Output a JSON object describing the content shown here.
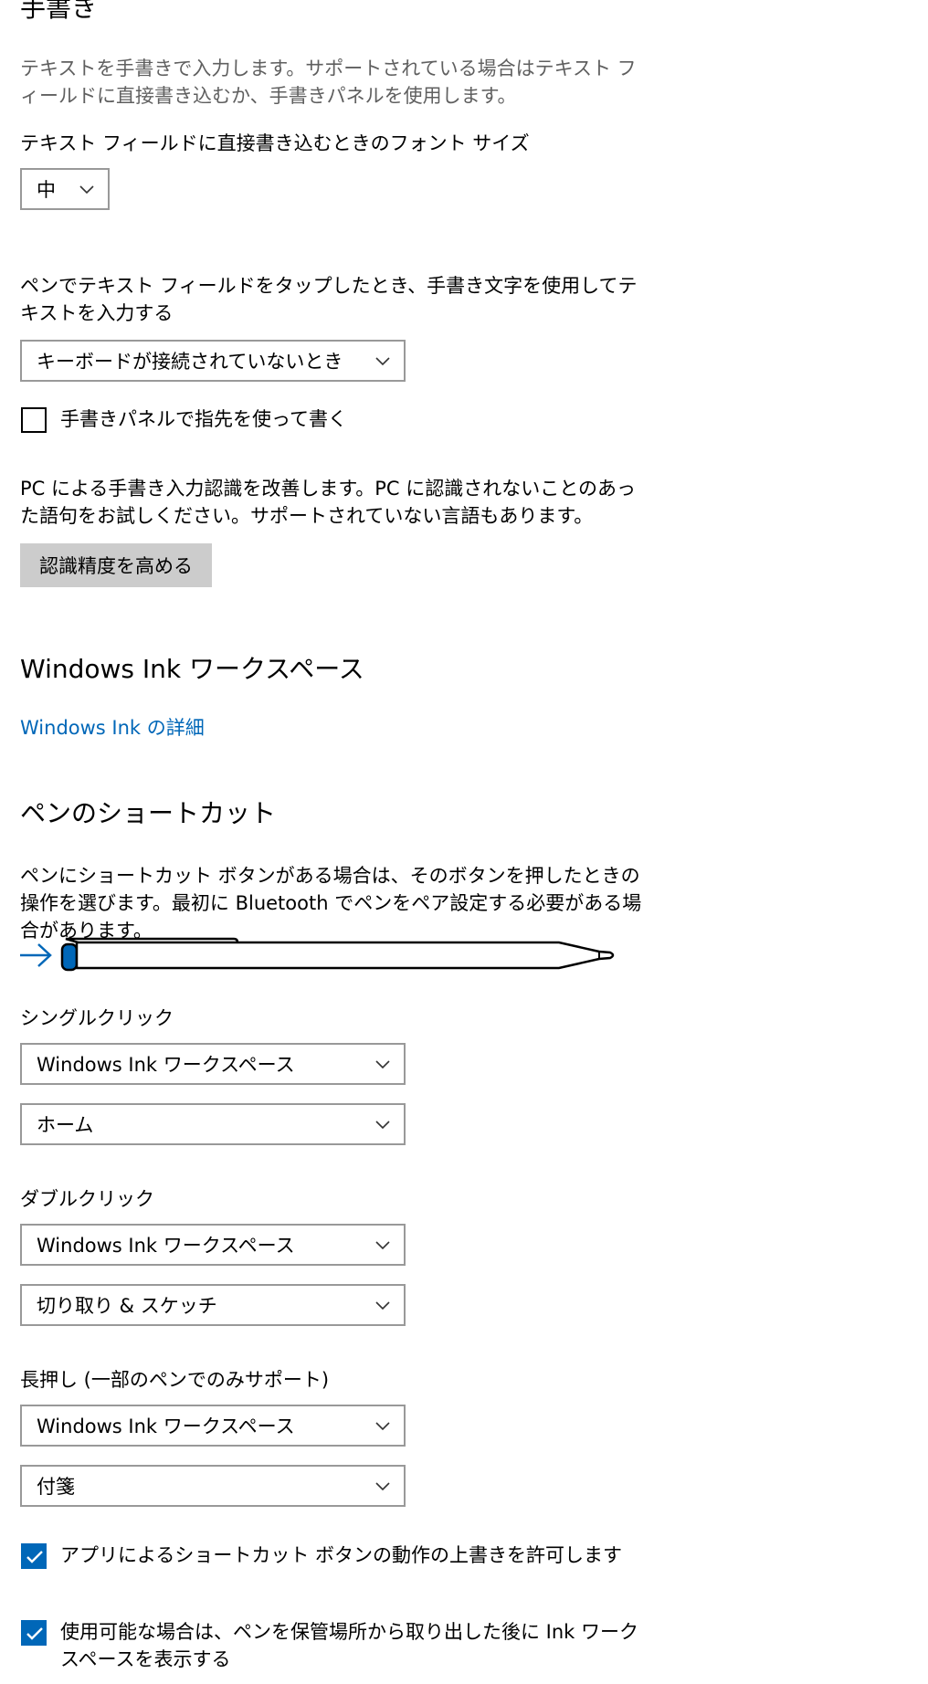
{
  "handwriting": {
    "title": "手書き",
    "description": "テキストを手書きで入力します。サポートされている場合はテキスト フィールドに直接書き込むか、手書きパネルを使用します。",
    "font_size_label": "テキスト フィールドに直接書き込むときのフォント サイズ",
    "font_size_value": "中",
    "tap_label": "ペンでテキスト フィールドをタップしたとき、手書き文字を使用してテキストを入力する",
    "tap_value": "キーボードが接続されていないとき",
    "finger_checkbox_label": "手書きパネルで指先を使って書く",
    "improve_text": "PC による手書き入力認識を改善します。PC に認識されないことのあった語句をお試しください。サポートされていない言語もあります。",
    "improve_button": "認識精度を高める"
  },
  "ink": {
    "title": "Windows Ink ワークスペース",
    "details_link": "Windows Ink の詳細"
  },
  "shortcuts": {
    "title": "ペンのショートカット",
    "description": "ペンにショートカット ボタンがある場合は、そのボタンを押したときの操作を選びます。最初に Bluetooth でペンをペア設定する必要がある場合があります。",
    "single_click_label": "シングルクリック",
    "single_click_app": "Windows Ink ワークスペース",
    "single_click_action": "ホーム",
    "double_click_label": "ダブルクリック",
    "double_click_app": "Windows Ink ワークスペース",
    "double_click_action": "切り取り & スケッチ",
    "long_press_label": "長押し (一部のペンでのみサポート)",
    "long_press_app": "Windows Ink ワークスペース",
    "long_press_action": "付箋",
    "override_checkbox_label": "アプリによるショートカット ボタンの動作の上書きを許可します",
    "show_ink_checkbox_label": "使用可能な場合は、ペンを保管場所から取り出した後に Ink ワークスペースを表示する"
  },
  "colors": {
    "accent": "#0067b8",
    "border": "#999999",
    "button_bg": "#cccccc"
  }
}
